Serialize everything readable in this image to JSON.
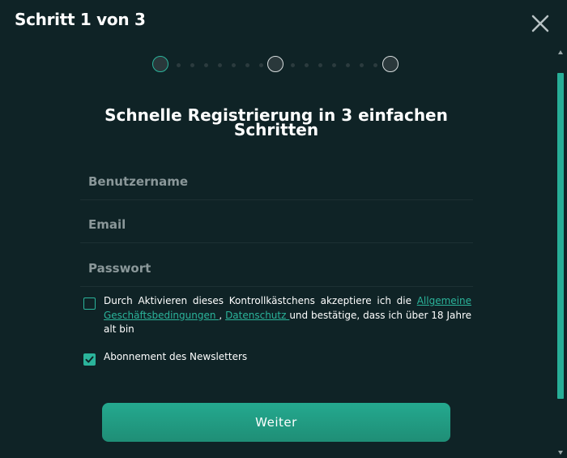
{
  "header": {
    "title": "Schritt 1 von 3"
  },
  "stepper": {
    "current_step": 1,
    "total_steps": 3
  },
  "form": {
    "heading": "Schnelle Registrierung in 3 einfachen Schritten",
    "username": {
      "placeholder": "Benutzername",
      "value": ""
    },
    "email": {
      "placeholder": "Email",
      "value": ""
    },
    "password": {
      "placeholder": "Passwort",
      "value": ""
    },
    "terms": {
      "checked": false,
      "text_before": "Durch Aktivieren dieses Kontrollkästchens akzeptiere ich die ",
      "link_terms": "Allgemeine Geschäftsbedingungen ",
      "separator": " , ",
      "link_privacy": "Datenschutz ",
      "text_after": "und bestätige, dass ich über 18 Jahre alt bin"
    },
    "newsletter": {
      "checked": true,
      "label": "Abonnement des Newsletters"
    },
    "submit_label": "Weiter"
  },
  "icons": {
    "close": "close-icon",
    "checkmark": "check-icon"
  },
  "colors": {
    "background": "#0f2326",
    "accent": "#2bb49b",
    "text": "#ffffff",
    "placeholder": "#8a9799"
  }
}
